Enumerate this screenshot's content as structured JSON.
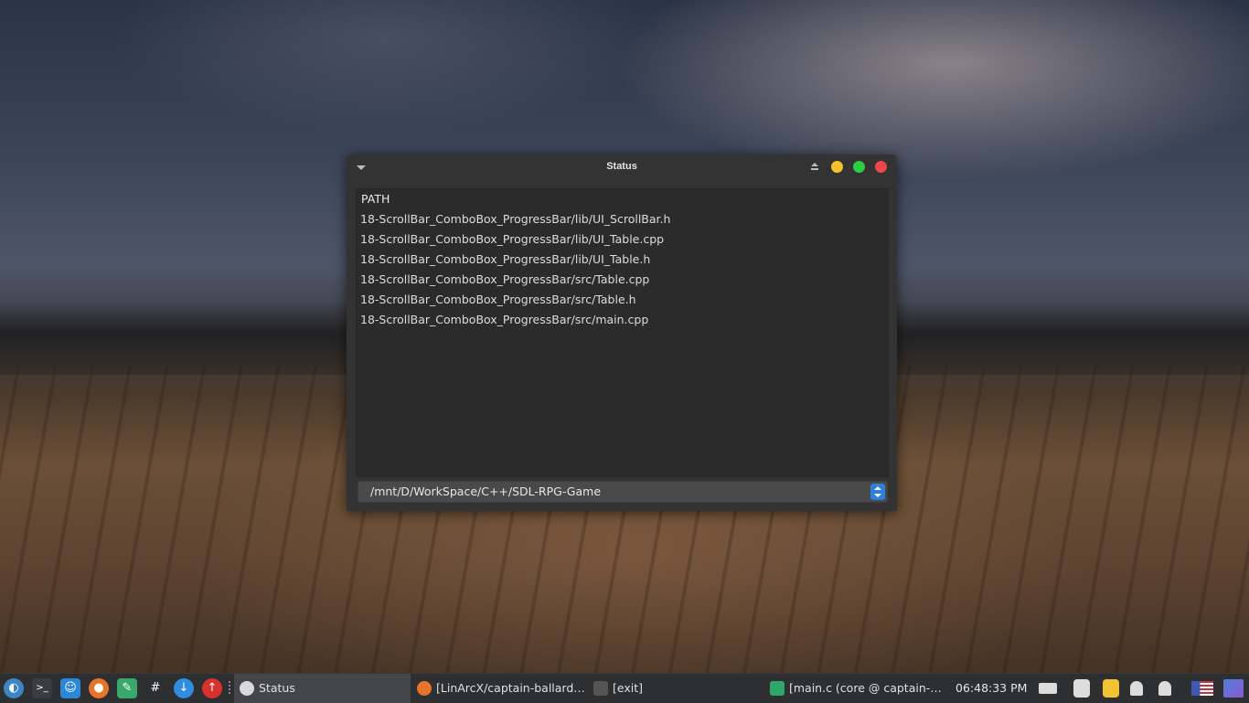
{
  "window": {
    "title": "Status",
    "list_header": "PATH",
    "rows": [
      "18-ScrollBar_ComboBox_ProgressBar/lib/UI_ScrollBar.h",
      "18-ScrollBar_ComboBox_ProgressBar/lib/UI_Table.cpp",
      "18-ScrollBar_ComboBox_ProgressBar/lib/UI_Table.h",
      "18-ScrollBar_ComboBox_ProgressBar/src/Table.cpp",
      "18-ScrollBar_ComboBox_ProgressBar/src/Table.h",
      "18-ScrollBar_ComboBox_ProgressBar/src/main.cpp"
    ],
    "combo_value": "/mnt/D/WorkSpace/C++/SDL-RPG-Game"
  },
  "taskbar": {
    "launchers": [
      {
        "name": "app-menu-icon",
        "glyph": "◐",
        "color": "#3d86c6"
      },
      {
        "name": "terminal-icon",
        "glyph": ">_",
        "color": "#3b3c3e"
      },
      {
        "name": "file-manager-icon",
        "glyph": "☺",
        "color": "#2d87d6"
      },
      {
        "name": "firefox-icon",
        "glyph": "●",
        "color": "#e8742a"
      },
      {
        "name": "text-editor-icon",
        "glyph": "✎",
        "color": "#3aa86a"
      },
      {
        "name": "hashtag-icon",
        "glyph": "#",
        "color": "#2e2f31"
      },
      {
        "name": "download-icon",
        "glyph": "↓",
        "color": "#2f8de0"
      },
      {
        "name": "upload-icon",
        "glyph": "↑",
        "color": "#d8322c"
      }
    ],
    "tasks": [
      {
        "label": "Status",
        "icon_color": "#d9d9d9"
      },
      {
        "label": "[LinArcX/captain-ballard: …",
        "icon_color": "#e8742a"
      },
      {
        "label": "[exit]",
        "icon_color": "#555555"
      },
      {
        "label": "[main.c (core @ captain-b…",
        "icon_color": "#2fa66a"
      }
    ],
    "clock": "06:48:33 PM",
    "tray": [
      {
        "name": "battery-icon",
        "color": "#dddddd"
      },
      {
        "name": "updates-icon",
        "color": "#dddddd"
      },
      {
        "name": "clipboard-icon",
        "color": "#f1c232"
      },
      {
        "name": "bell-icon",
        "color": "#dddddd"
      },
      {
        "name": "volume-icon",
        "color": "#dddddd"
      },
      {
        "name": "us-flag-icon",
        "color": "#3c5bb0"
      },
      {
        "name": "desktop-icon",
        "color": "#6b5ec8"
      }
    ]
  }
}
